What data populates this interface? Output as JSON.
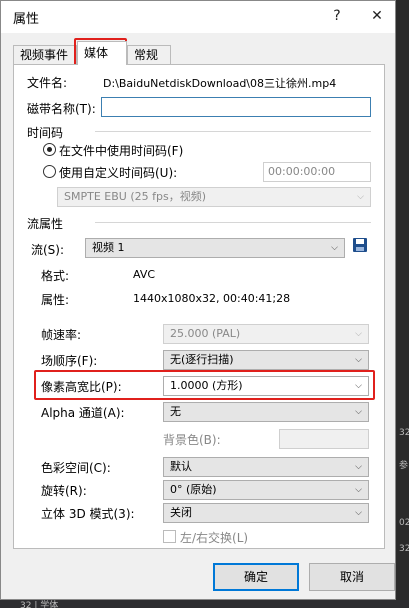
{
  "window": {
    "title": "属性",
    "help": "?",
    "close": "✕"
  },
  "tabs": [
    {
      "label": "视频事件"
    },
    {
      "label": "媒体"
    },
    {
      "label": "常规"
    }
  ],
  "file": {
    "label": "文件名:",
    "value": "D:\\BaiduNetdiskDownload\\08三让徐州.mp4"
  },
  "tape": {
    "label": "磁带名称(T):",
    "value": ""
  },
  "timecode": {
    "section": "时间码",
    "opt1": "在文件中使用时间码(F)",
    "opt2": "使用自定义时间码(U):",
    "custom_value": "00:00:00:00",
    "format": "SMPTE EBU (25 fps，视频)"
  },
  "stream": {
    "section": "流属性",
    "label": "流(S):",
    "value": "视频 1",
    "format_label": "格式:",
    "format_value": "AVC",
    "attr_label": "属性:",
    "attr_value": "1440x1080x32, 00:40:41;28"
  },
  "props": {
    "framerate": {
      "label": "帧速率:",
      "value": "25.000 (PAL)"
    },
    "field_order": {
      "label": "场顺序(F):",
      "value": "无(逐行扫描)"
    },
    "pixel_aspect": {
      "label": "像素高宽比(P):",
      "value": "1.0000 (方形)"
    },
    "alpha": {
      "label": "Alpha 通道(A):",
      "value": "无"
    },
    "bgcolor": {
      "label": "背景色(B):"
    },
    "colorspace": {
      "label": "色彩空间(C):",
      "value": "默认"
    },
    "rotation": {
      "label": "旋转(R):",
      "value": "0° (原始)"
    },
    "stereo": {
      "label": "立体 3D 模式(3):",
      "value": "关闭"
    },
    "swap": {
      "label": "左/右交换(L)"
    }
  },
  "buttons": {
    "ok": "确定",
    "cancel": "取消"
  },
  "background": {
    "r1": "32",
    "r2": "参",
    "r3": "02",
    "r4": "32",
    "bottom": "32 | 学体"
  },
  "colors": {
    "highlight": "#e0201c",
    "accent": "#0078d7"
  }
}
